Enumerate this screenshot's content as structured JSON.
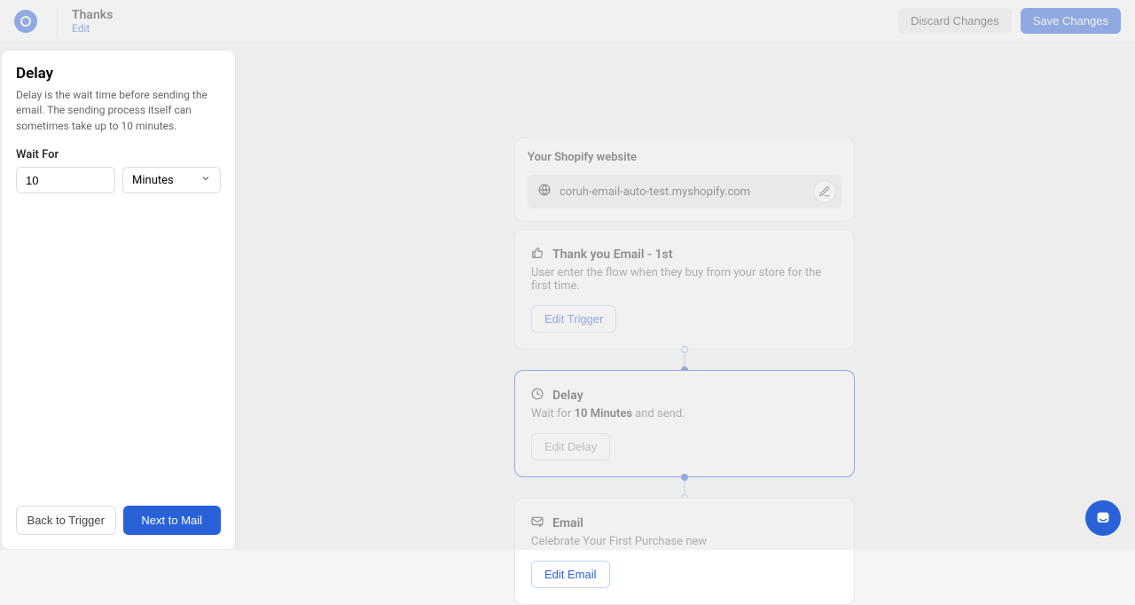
{
  "topbar": {
    "title": "Thanks",
    "edit_label": "Edit",
    "discard_label": "Discard Changes",
    "save_label": "Save Changes"
  },
  "panel": {
    "title": "Delay",
    "desc": "Delay is the wait time before sending the email. The sending process itself can sometimes take up to 10 minutes.",
    "wait_for_label": "Wait For",
    "wait_value": "10",
    "unit_selected": "Minutes",
    "back_label": "Back to Trigger",
    "next_label": "Next to Mail"
  },
  "shopify": {
    "header": "Your Shopify website",
    "domain": "coruh-email-auto-test.myshopify.com"
  },
  "trigger": {
    "title": "Thank you Email - 1st",
    "desc": "User enter the flow when they buy from your store for the first time.",
    "button": "Edit Trigger"
  },
  "delay": {
    "title": "Delay",
    "desc_prefix": "Wait for ",
    "desc_bold": "10 Minutes",
    "desc_suffix": " and send.",
    "button": "Edit Delay"
  },
  "email": {
    "title": "Email",
    "desc": "Celebrate Your First Purchase new",
    "button": "Edit Email"
  }
}
